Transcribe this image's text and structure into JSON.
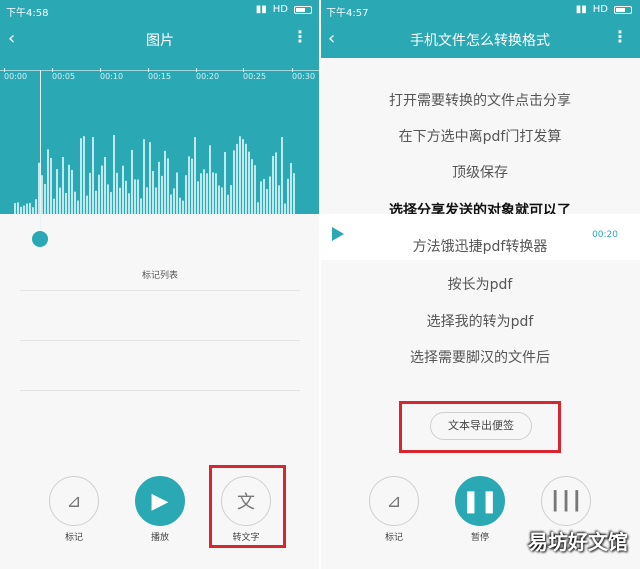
{
  "left_panel": {
    "status_time": "下午4:58",
    "status_network": "HD",
    "title": "图片",
    "timeline_ticks": [
      "00:00",
      "00:05",
      "00:10",
      "00:15",
      "00:20",
      "00:25",
      "00:30"
    ],
    "marks_title": "标记列表",
    "controls": {
      "mark_label": "标记",
      "play_label": "播放",
      "transcribe_label": "转文字",
      "transcribe_glyph": "文"
    }
  },
  "right_panel": {
    "status_time": "下午4:57",
    "status_network": "HD",
    "title": "手机文件怎么转换格式",
    "lines": [
      "打开需要转换的文件点击分享",
      "在下方选中离pdf门打发算",
      "顶级保存",
      "选择分享发送的对象就可以了",
      "方法饿迅捷pdf转换器",
      "按长为pdf",
      "选择我的转为pdf",
      "选择需要脚汉的文件后"
    ],
    "player_duration": "00:20",
    "export_button": "文本导出便签",
    "controls": {
      "mark_label": "标记",
      "pause_label": "暂停"
    }
  },
  "watermark": "易坊好文馆",
  "colors": {
    "accent": "#2aa8b4",
    "highlight_box": "#d8262f"
  }
}
